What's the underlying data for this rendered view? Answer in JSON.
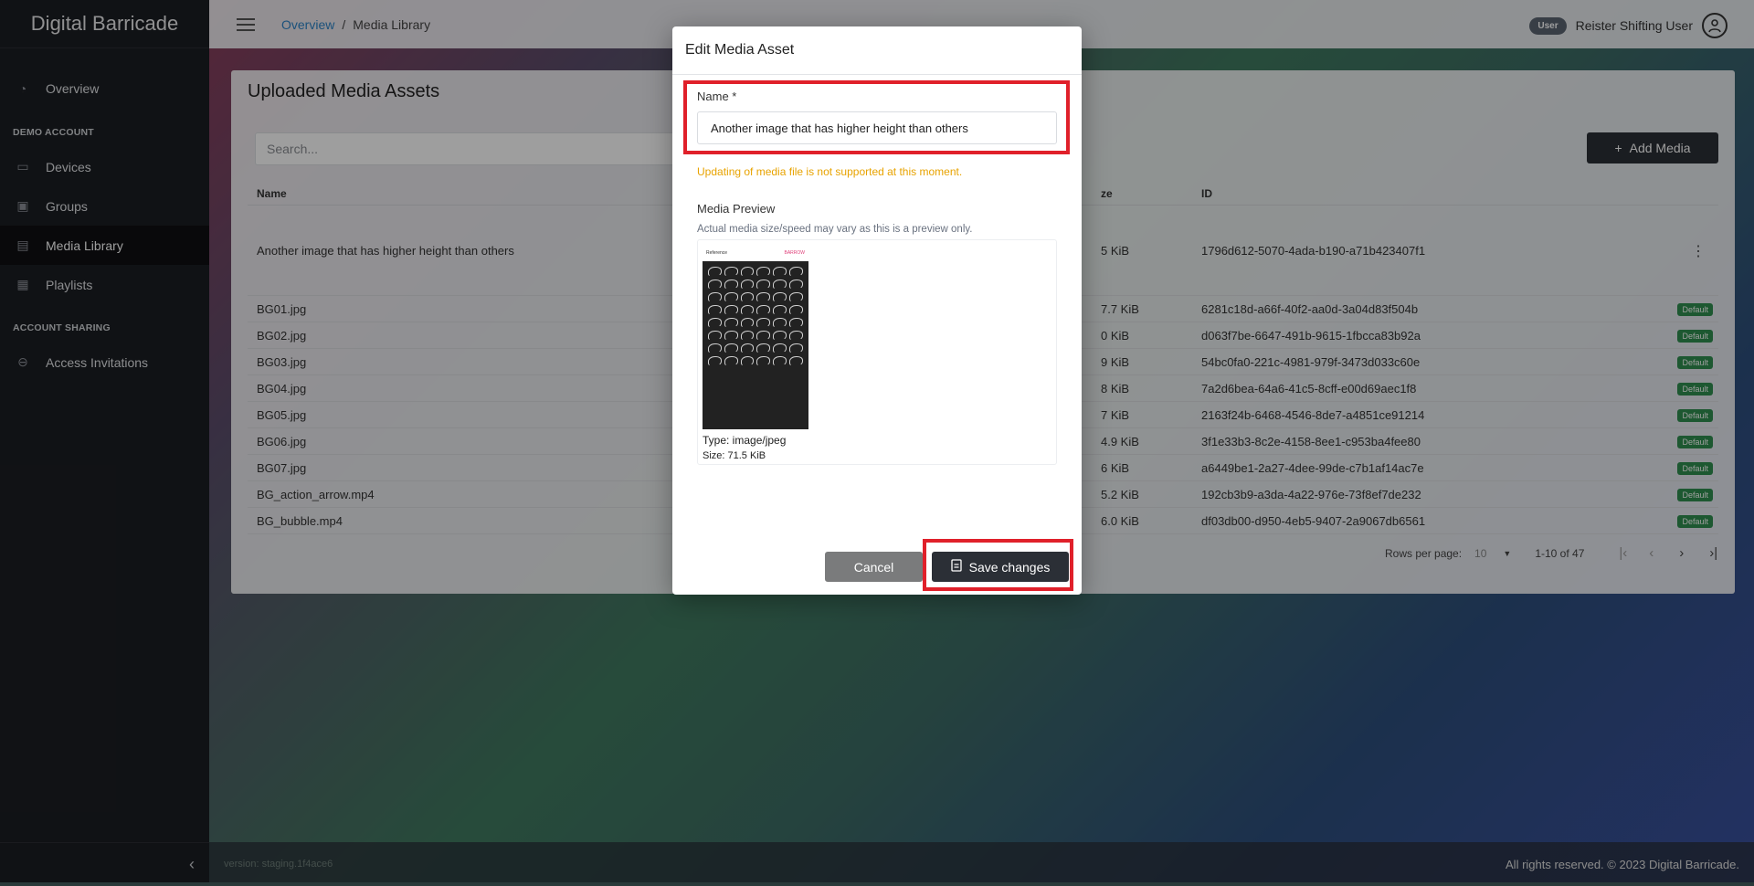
{
  "app": {
    "title": "Digital Barricade"
  },
  "sidebar": {
    "items": [
      {
        "label": "Overview",
        "icon": "dashboard-icon"
      },
      {
        "section": "DEMO ACCOUNT"
      },
      {
        "label": "Devices",
        "icon": "devices-icon"
      },
      {
        "label": "Groups",
        "icon": "groups-icon"
      },
      {
        "label": "Media Library",
        "icon": "film-icon",
        "active": true
      },
      {
        "label": "Playlists",
        "icon": "playlist-icon"
      },
      {
        "section": "ACCOUNT SHARING"
      },
      {
        "label": "Access Invitations",
        "icon": "lock-icon"
      }
    ],
    "collapse_icon": "chevron-left-icon"
  },
  "topbar": {
    "breadcrumb": [
      "Overview",
      "/",
      "Media Library"
    ],
    "user_badge": "User",
    "user_name": "Reister Shifting User"
  },
  "card": {
    "title": "Uploaded Media Assets",
    "search_placeholder": "Search...",
    "add_button": "Add Media",
    "columns": {
      "name": "Name",
      "size": "ze",
      "id": "ID"
    },
    "rows": [
      {
        "name": "Another image that has higher height than others",
        "size": "5 KiB",
        "id": "1796d612-5070-4ada-b190-a71b423407f1",
        "badge": ""
      },
      {
        "name": "BG01.jpg",
        "size": "7.7 KiB",
        "id": "6281c18d-a66f-40f2-aa0d-3a04d83f504b",
        "badge": "Default"
      },
      {
        "name": "BG02.jpg",
        "size": "0 KiB",
        "id": "d063f7be-6647-491b-9615-1fbcca83b92a",
        "badge": "Default"
      },
      {
        "name": "BG03.jpg",
        "size": "9 KiB",
        "id": "54bc0fa0-221c-4981-979f-3473d033c60e",
        "badge": "Default"
      },
      {
        "name": "BG04.jpg",
        "size": "8 KiB",
        "id": "7a2d6bea-64a6-41c5-8cff-e00d69aec1f8",
        "badge": "Default"
      },
      {
        "name": "BG05.jpg",
        "size": "7 KiB",
        "id": "2163f24b-6468-4546-8de7-a4851ce91214",
        "badge": "Default"
      },
      {
        "name": "BG06.jpg",
        "size": "4.9 KiB",
        "id": "3f1e33b3-8c2e-4158-8ee1-c953ba4fee80",
        "badge": "Default"
      },
      {
        "name": "BG07.jpg",
        "size": "6 KiB",
        "id": "a6449be1-2a27-4dee-99de-c7b1af14ac7e",
        "badge": "Default"
      },
      {
        "name": "BG_action_arrow.mp4",
        "size": "5.2 KiB",
        "id": "192cb3b9-a3da-4a22-976e-73f8ef7de232",
        "badge": "Default"
      },
      {
        "name": "BG_bubble.mp4",
        "size": "6.0 KiB",
        "id": "df03db00-d950-4eb5-9407-2a9067db6561",
        "badge": "Default"
      }
    ],
    "pager": {
      "rows_per_page_label": "Rows per page:",
      "rows_per_page": "10",
      "range": "1-10 of 47"
    }
  },
  "footer": {
    "version": "version: staging.1f4ace6",
    "copyright": "All rights reserved. © 2023 Digital Barricade."
  },
  "modal": {
    "title": "Edit Media Asset",
    "name_label": "Name *",
    "name_value": "Another image that has higher height than others",
    "warning": "Updating of media file is not supported at this moment.",
    "preview_label": "Media Preview",
    "preview_note": "Actual media size/speed may vary as this is a preview only.",
    "preview_header_left": "Reference",
    "preview_header_right": "BARROW",
    "type": "Type: image/jpeg",
    "size": "Size: 71.5 KiB",
    "cancel": "Cancel",
    "save": "Save changes"
  },
  "colors": {
    "highlight": "#e0202a",
    "warning": "#e8a300",
    "badge": "#2f8f4f",
    "dark_button": "#2b2f36"
  }
}
